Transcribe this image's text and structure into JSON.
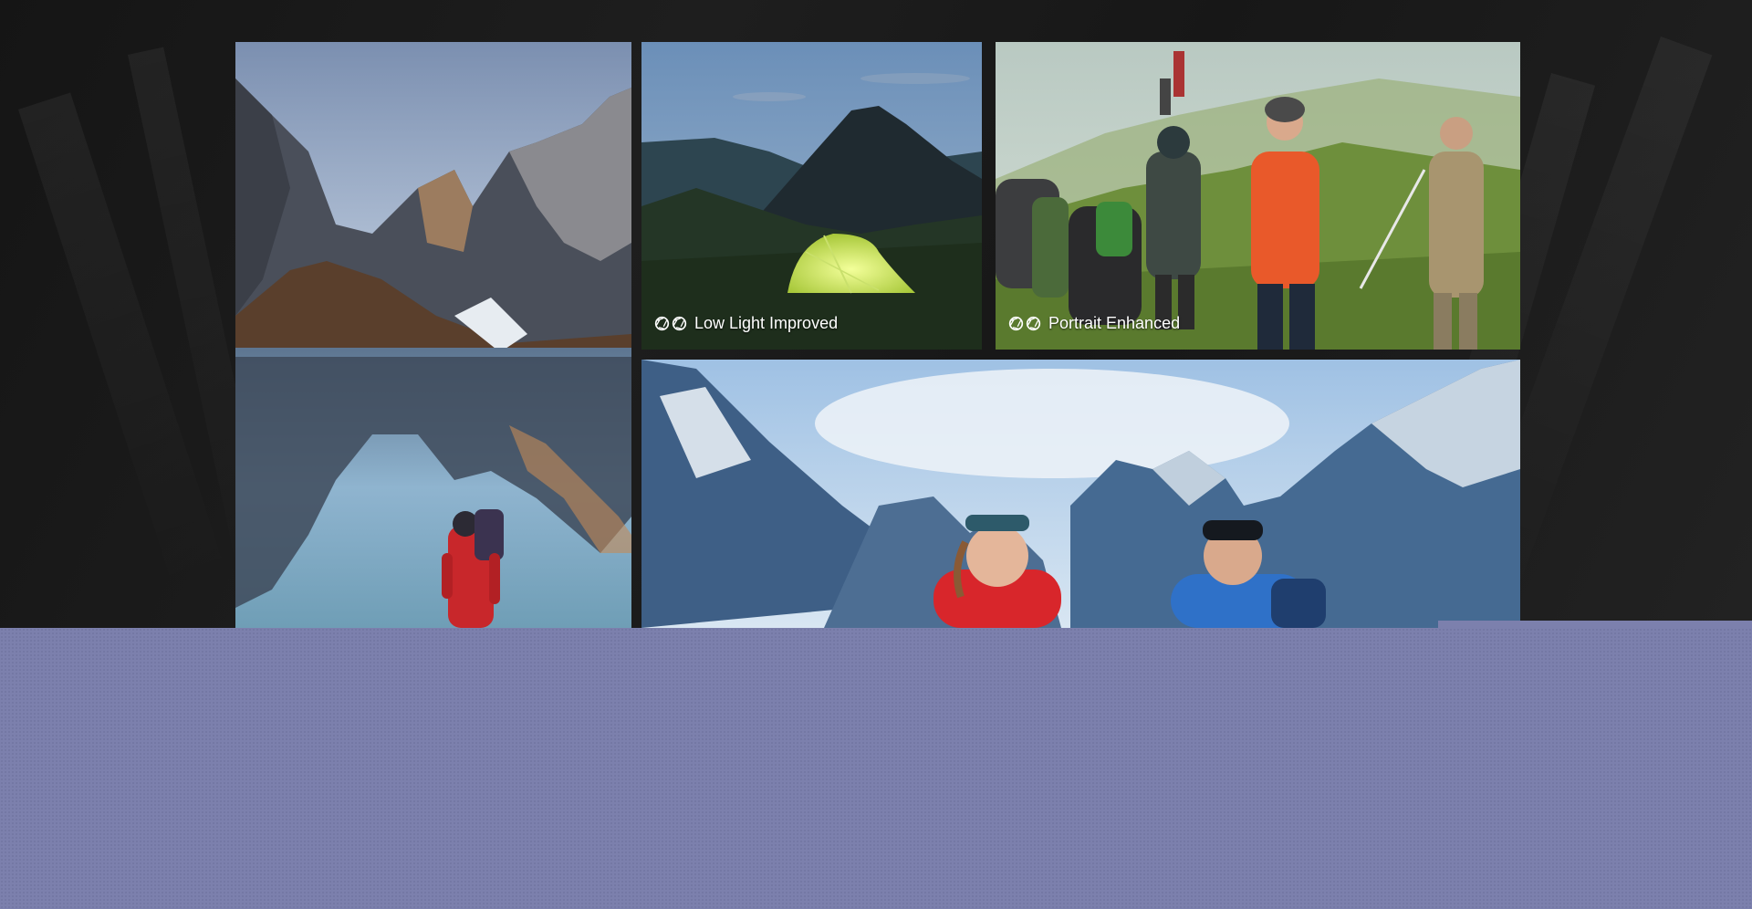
{
  "gallery": {
    "tiles": [
      {
        "name": "lake-hiker-photo",
        "caption": ""
      },
      {
        "name": "tent-night-photo",
        "caption": "Low Light Improved",
        "icon": "aperture-icon"
      },
      {
        "name": "hiking-group-photo",
        "caption": "Portrait Enhanced",
        "icon": "aperture-icon"
      },
      {
        "name": "hiking-couple-photo",
        "caption": ""
      }
    ]
  },
  "colors": {
    "background_dark": "#1a1a1a",
    "bottom_band": "#7c80ad",
    "caption_text": "#ffffff"
  }
}
